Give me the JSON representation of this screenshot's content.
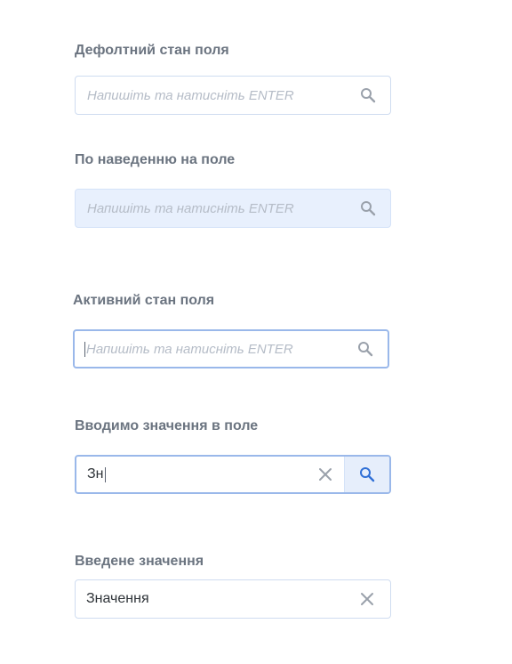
{
  "states": {
    "default": {
      "label": "Дефолтний стан поля",
      "placeholder": "Напишіть та натисніть ENTER"
    },
    "hover": {
      "label": "По наведенню на поле",
      "placeholder": "Напишіть та натисніть ENTER"
    },
    "active": {
      "label": "Активний стан поля",
      "placeholder": "Напишіть та натисніть ENTER"
    },
    "typing": {
      "label": "Вводимо значення в поле",
      "value": "Зн"
    },
    "entered": {
      "label": "Введене значення",
      "value": "Значення"
    }
  },
  "icons": {
    "search": "search-icon",
    "clear": "close-icon"
  },
  "colors": {
    "label": "#6b7480",
    "placeholder": "#b5bcc7",
    "border": "#cfdcf0",
    "hover_bg": "#e8f0fd",
    "active_border": "#9ab8ea",
    "accent": "#2f6fd6",
    "icon_muted": "#9aa1ab"
  }
}
